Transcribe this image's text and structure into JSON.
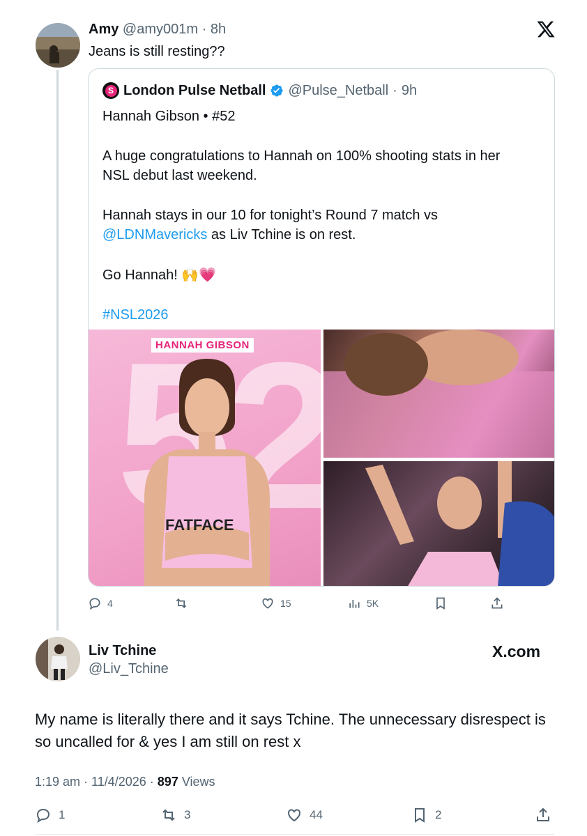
{
  "tweet": {
    "author": {
      "name": "Amy",
      "handle": "@amy001m",
      "time": "8h"
    },
    "text": "Jeans is still resting??"
  },
  "quoted": {
    "author": {
      "name": "London Pulse Netball",
      "handle": "@Pulse_Netball",
      "time": "9h",
      "logo_letter": "S"
    },
    "body": {
      "line1": "Hannah Gibson • #52",
      "line2a": "A huge congratulations to Hannah on 100% shooting stats in her",
      "line2b": "NSL debut last weekend.",
      "line3a": "Hannah stays in our 10 for tonight’s Round 7 match vs",
      "mention": "@LDNMavericks",
      "line3b": " as Liv Tchine is on rest.",
      "line4": "Go Hannah! ",
      "line4_emoji": "🙌💗",
      "hashtag": "#NSL2026"
    },
    "media": {
      "name_tag": "HANNAH GIBSON",
      "number": "52",
      "sponsor": "FATFACE"
    },
    "actions": {
      "replies": "4",
      "retweets": "",
      "likes": "15",
      "views": "5K"
    }
  },
  "reply": {
    "author": {
      "name": "Liv Tchine",
      "handle": "@Liv_Tchine"
    },
    "brand": "X.com",
    "text": "My name is literally there and it says Tchine. The unnecessary disrespect is so uncalled for & yes I am still on rest x",
    "meta": {
      "time": "1:19 am",
      "date": "11/4/2026",
      "views": "897",
      "views_label": "Views"
    },
    "actions": {
      "replies": "1",
      "retweets": "3",
      "likes": "44",
      "bookmarks": "2"
    }
  },
  "colors": {
    "link": "#1d9bf0",
    "muted": "#536471",
    "verified": "#1d9bf0",
    "brand_pink": "#e6257a"
  },
  "icons": [
    "x-logo-icon",
    "verified-badge-icon",
    "reply-icon",
    "retweet-icon",
    "like-icon",
    "views-icon",
    "bookmark-icon",
    "share-icon"
  ]
}
